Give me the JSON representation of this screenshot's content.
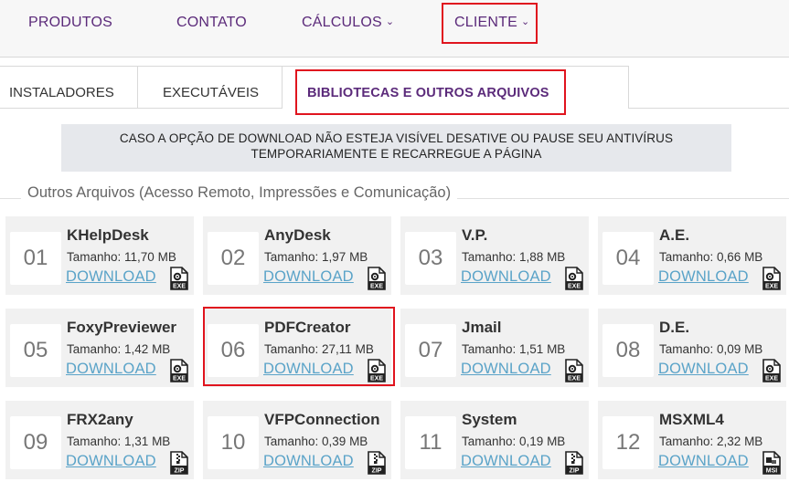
{
  "nav": {
    "produtos": "PRODUTOS",
    "contato": "CONTATO",
    "calculos": "CÁLCULOS",
    "cliente": "CLIENTE",
    "chevron": "⌄"
  },
  "tabs": {
    "instaladores": "INSTALADORES",
    "executaveis": "EXECUTÁVEIS",
    "bibliotecas": "BIBLIOTECAS E OUTROS ARQUIVOS"
  },
  "notice": {
    "line1": "CASO A OPÇÃO DE DOWNLOAD NÃO ESTEJA VISÍVEL DESATIVE OU PAUSE SEU ANTIVÍRUS",
    "line2": "TEMPORARIAMENTE E RECARREGUE A PÁGINA"
  },
  "section_title": "Outros Arquivos (Acesso Remoto, Impressões e Comunicação)",
  "files": [
    {
      "num": "01",
      "name": "KHelpDesk",
      "size": "Tamanho: 11,70 MB",
      "download": "DOWNLOAD",
      "type": "EXE"
    },
    {
      "num": "02",
      "name": "AnyDesk",
      "size": "Tamanho: 1,97 MB",
      "download": "DOWNLOAD",
      "type": "EXE"
    },
    {
      "num": "03",
      "name": "V.P.",
      "size": "Tamanho: 1,88 MB",
      "download": "DOWNLOAD",
      "type": "EXE"
    },
    {
      "num": "04",
      "name": "A.E.",
      "size": "Tamanho: 0,66 MB",
      "download": "DOWNLOAD",
      "type": "EXE"
    },
    {
      "num": "05",
      "name": "FoxyPreviewer",
      "size": "Tamanho: 1,42 MB",
      "download": "DOWNLOAD",
      "type": "EXE"
    },
    {
      "num": "06",
      "name": "PDFCreator",
      "size": "Tamanho: 27,11 MB",
      "download": "DOWNLOAD",
      "type": "EXE"
    },
    {
      "num": "07",
      "name": "Jmail",
      "size": "Tamanho: 1,51 MB",
      "download": "DOWNLOAD",
      "type": "EXE"
    },
    {
      "num": "08",
      "name": "D.E.",
      "size": "Tamanho: 0,09 MB",
      "download": "DOWNLOAD",
      "type": "EXE"
    },
    {
      "num": "09",
      "name": "FRX2any",
      "size": "Tamanho: 1,31 MB",
      "download": "DOWNLOAD",
      "type": "ZIP"
    },
    {
      "num": "10",
      "name": "VFPConnection",
      "size": "Tamanho: 0,39 MB",
      "download": "DOWNLOAD",
      "type": "ZIP"
    },
    {
      "num": "11",
      "name": "System",
      "size": "Tamanho: 0,19 MB",
      "download": "DOWNLOAD",
      "type": "ZIP"
    },
    {
      "num": "12",
      "name": "MSXML4",
      "size": "Tamanho: 2,32 MB",
      "download": "DOWNLOAD",
      "type": "MSI"
    }
  ],
  "colors": {
    "brand_purple": "#5b2a7a",
    "link_blue": "#5aa3c8",
    "highlight_red": "#e0141e",
    "card_bg": "#f1f1f1",
    "notice_bg": "#e6e8ec"
  }
}
